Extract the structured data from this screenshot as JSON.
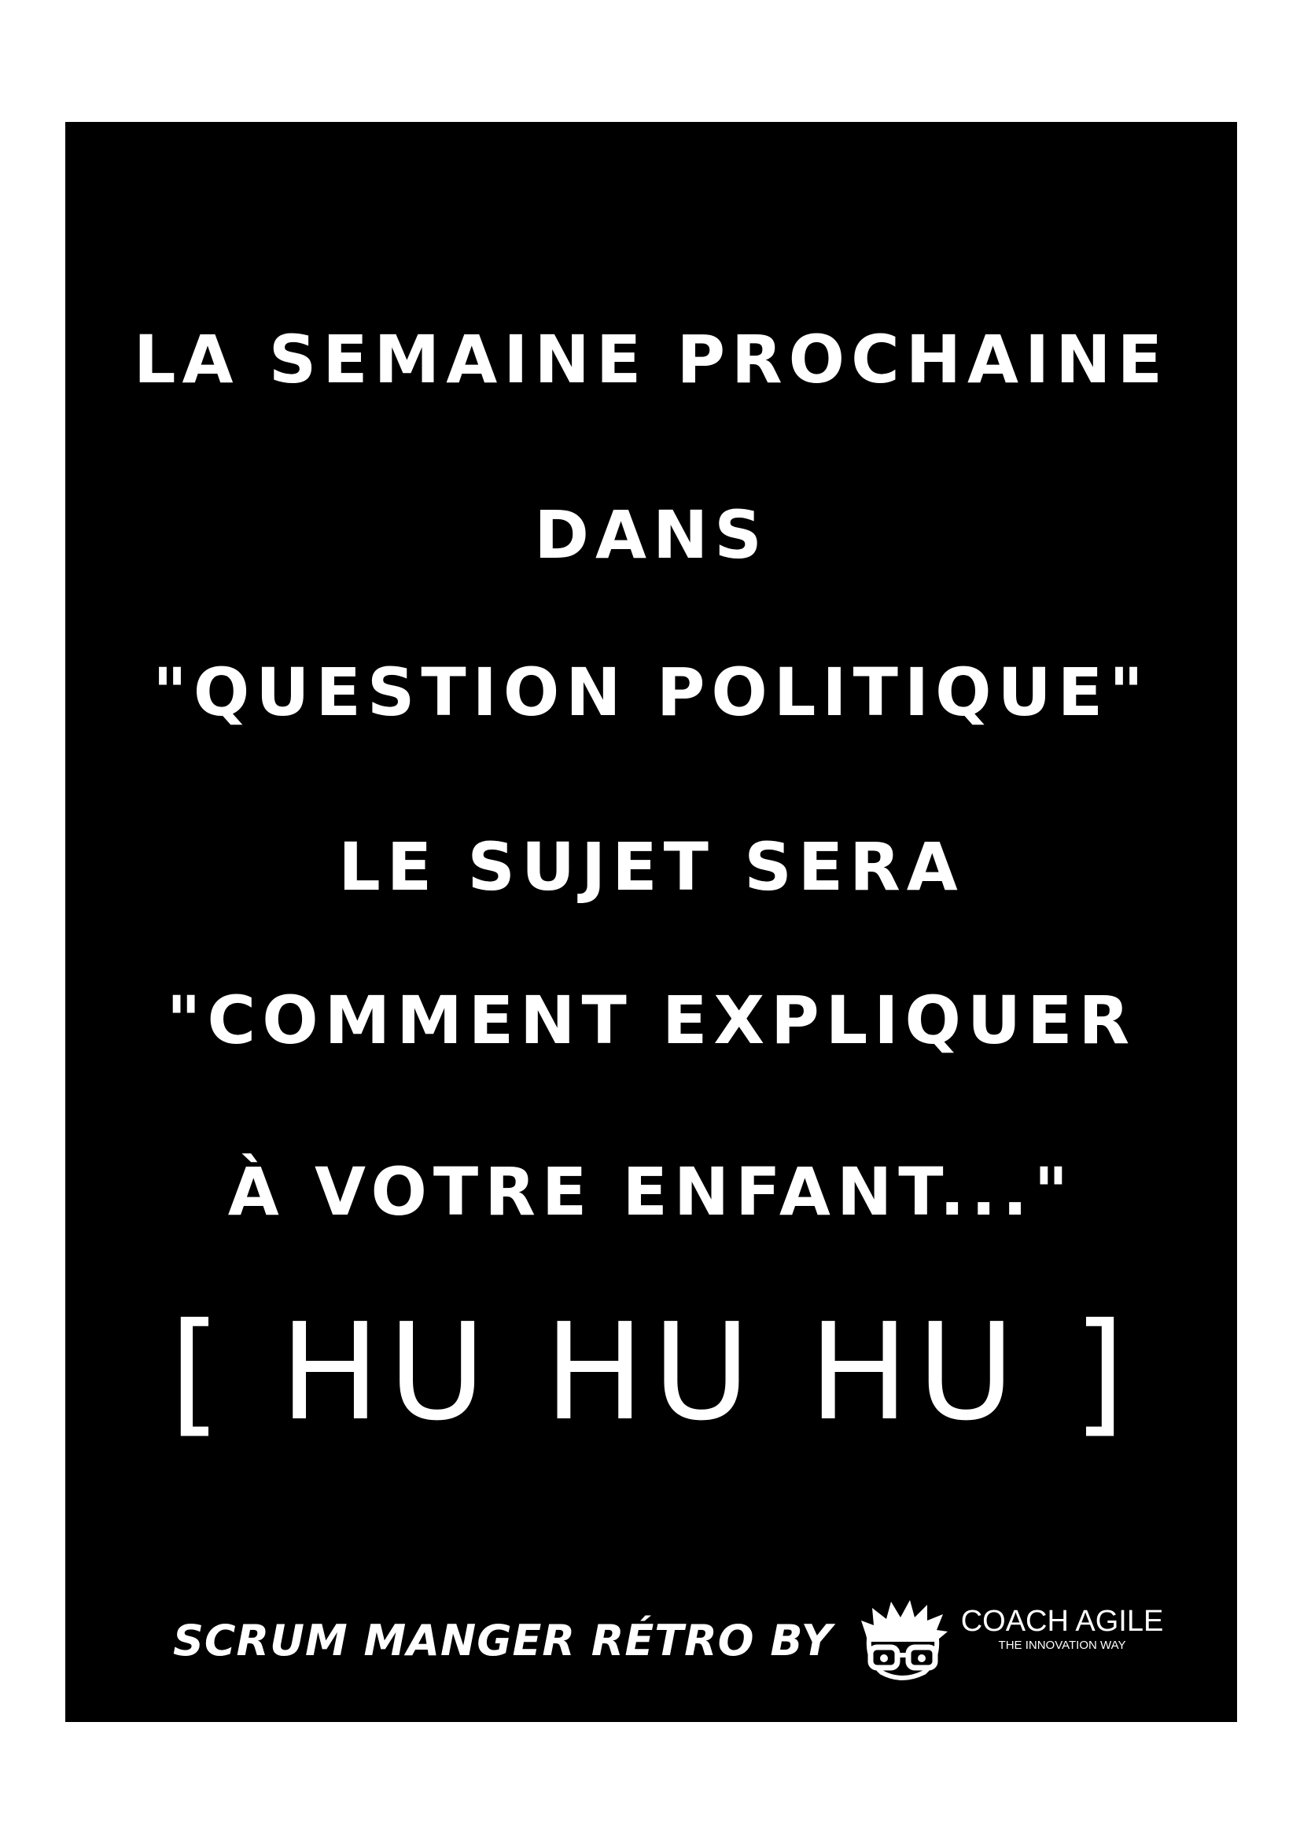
{
  "poster": {
    "lines": [
      "LA SEMAINE PROCHAINE",
      "DANS",
      "\"QUESTION POLITIQUE\"",
      "LE SUJET SERA",
      "\"COMMENT EXPLIQUER",
      "À VOTRE ENFANT...\""
    ],
    "punchline": "[ HU HU HU ]"
  },
  "footer": {
    "credit": "SCRUM MANGER RÉTRO BY",
    "brand_name": "COACH AGILE",
    "brand_tagline": "THE INNOVATION WAY",
    "logo_icon": "glasses-face-icon"
  },
  "colors": {
    "background": "#ffffff",
    "poster": "#000000",
    "text": "#ffffff"
  }
}
